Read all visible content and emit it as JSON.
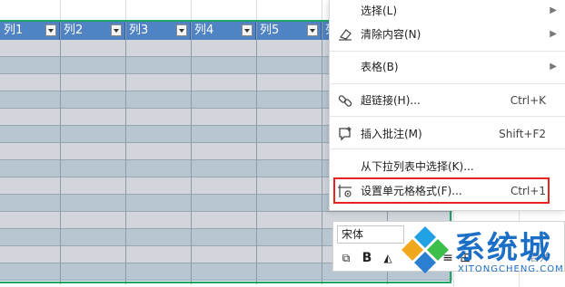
{
  "table": {
    "columns": [
      "列1",
      "列2",
      "列3",
      "列4",
      "列5",
      "列"
    ]
  },
  "context_menu": {
    "items": [
      {
        "label": "选择(L)",
        "shortcut": "",
        "submenu": true,
        "icon": ""
      },
      {
        "label": "清除内容(N)",
        "shortcut": "",
        "submenu": true,
        "icon": "eraser-icon"
      },
      {
        "label": "表格(B)",
        "shortcut": "",
        "submenu": true,
        "icon": ""
      },
      {
        "label": "超链接(H)...",
        "shortcut": "Ctrl+K",
        "submenu": false,
        "icon": "link-icon"
      },
      {
        "label": "插入批注(M)",
        "shortcut": "Shift+F2",
        "submenu": false,
        "icon": "comment-icon"
      },
      {
        "label": "从下拉列表中选择(K)...",
        "shortcut": "",
        "submenu": false,
        "icon": ""
      },
      {
        "label": "设置单元格格式(F)...",
        "shortcut": "Ctrl+1",
        "submenu": false,
        "icon": "format-cells-icon",
        "highlighted": true
      }
    ],
    "highlight_color": "#e8231f"
  },
  "mini_toolbar": {
    "font_name": "宋体",
    "merge_label": "合并"
  },
  "watermark": {
    "text": "系统城",
    "subtext": "XITONGCHENG.COM"
  },
  "colors": {
    "header_bg": "#4f83c4",
    "row_light": "#d2d6dc",
    "row_dark": "#b8c6d2",
    "selection_border": "#21a366"
  }
}
